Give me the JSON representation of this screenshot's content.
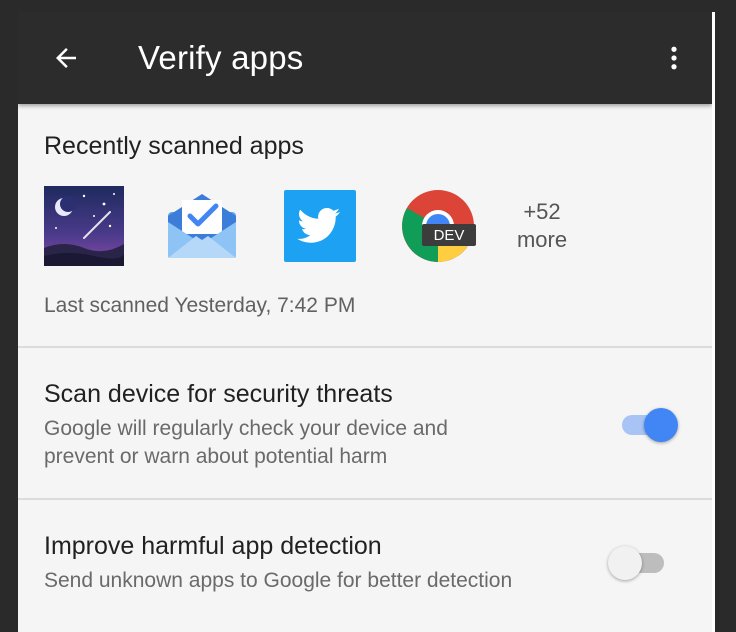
{
  "toolbar": {
    "title": "Verify apps",
    "back_icon": "arrow-left-icon",
    "more_icon": "more-vert-icon"
  },
  "recent": {
    "heading": "Recently scanned apps",
    "apps": [
      {
        "icon": "night-sky-app-icon"
      },
      {
        "icon": "inbox-app-icon"
      },
      {
        "icon": "twitter-app-icon"
      },
      {
        "icon": "chrome-dev-app-icon",
        "badge": "DEV"
      }
    ],
    "more_count": "+52",
    "more_label": "more",
    "last_scanned": "Last scanned Yesterday, 7:42 PM"
  },
  "settings": [
    {
      "title": "Scan device for security threats",
      "subtitle_line1": "Google will regularly check your device and",
      "subtitle_line2": "prevent or warn about potential harm",
      "enabled": true
    },
    {
      "title": "Improve harmful app detection",
      "subtitle_line1": "Send unknown apps to Google for better detection",
      "enabled": false
    }
  ],
  "colors": {
    "toolbar_bg": "#2c2c2c",
    "accent": "#4285f4",
    "background": "#f5f5f5"
  }
}
